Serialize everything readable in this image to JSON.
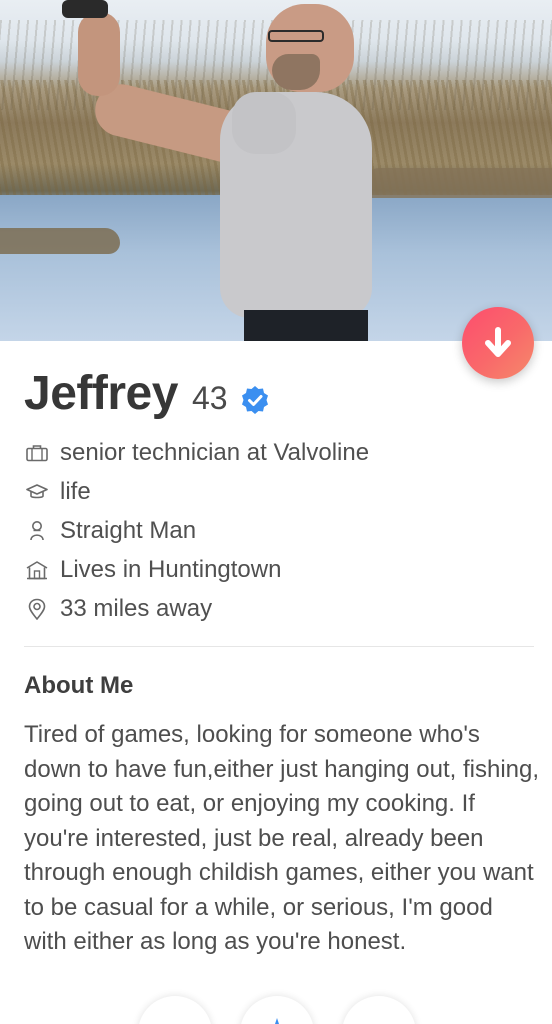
{
  "profile": {
    "name": "Jeffrey",
    "age": "43",
    "verified_icon": "verified-badge-icon",
    "details": [
      {
        "icon": "briefcase-icon",
        "text": "senior technician at Valvoline"
      },
      {
        "icon": "graduation-cap-icon",
        "text": "life"
      },
      {
        "icon": "person-icon",
        "text": "Straight Man"
      },
      {
        "icon": "home-icon",
        "text": "Lives in Huntingtown"
      },
      {
        "icon": "location-pin-icon",
        "text": "33 miles away"
      }
    ]
  },
  "about": {
    "title": "About Me",
    "text": "Tired of games, looking for someone who's down to have fun,either just hanging out, fishing, going out to eat, or enjoying my cooking. If you're interested, just be real, already been through enough childish games, either you want to be casual for a while, or serious, I'm good with either as long as you're honest."
  },
  "colors": {
    "accent_gradient_start": "#fd4d6e",
    "accent_gradient_end": "#f58a6b",
    "verified_blue": "#3b8ff0",
    "text_primary": "#373737",
    "text_secondary": "#505050"
  },
  "actions": {
    "collapse_icon": "arrow-down-icon"
  }
}
